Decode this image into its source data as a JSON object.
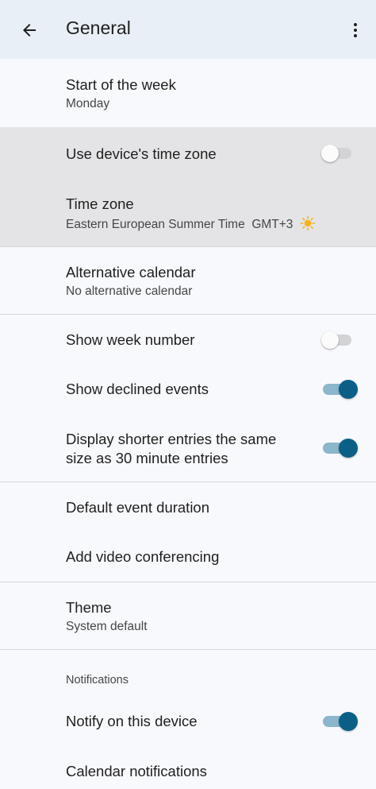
{
  "appbar": {
    "title": "General",
    "back_icon": "arrow-back-icon",
    "more_icon": "more-vert-icon"
  },
  "settings": {
    "start_of_week": {
      "label": "Start of the week",
      "value": "Monday"
    },
    "use_device_tz": {
      "label": "Use device's time zone",
      "enabled": false
    },
    "time_zone": {
      "label": "Time zone",
      "value": "Eastern European Summer Time  GMT+3",
      "icon": "sun-icon"
    },
    "alt_calendar": {
      "label": "Alternative calendar",
      "value": "No alternative calendar"
    },
    "show_week_number": {
      "label": "Show week number",
      "enabled": false
    },
    "show_declined": {
      "label": "Show declined events",
      "enabled": true
    },
    "shorter_entries": {
      "label_line1": "Display shorter entries the same",
      "label_line2": "size as 30 minute entries",
      "enabled": true
    },
    "default_duration": {
      "label": "Default event duration"
    },
    "video_conf": {
      "label": "Add video conferencing"
    },
    "theme": {
      "label": "Theme",
      "value": "System default"
    },
    "notifications_header": "Notifications",
    "notify_device": {
      "label": "Notify on this device",
      "enabled": true
    },
    "calendar_notifications": {
      "label": "Calendar notifications"
    }
  },
  "colors": {
    "appbar_bg": "#e8eff6",
    "accent": "#0b5f86",
    "highlight": "#e4e4e6"
  }
}
